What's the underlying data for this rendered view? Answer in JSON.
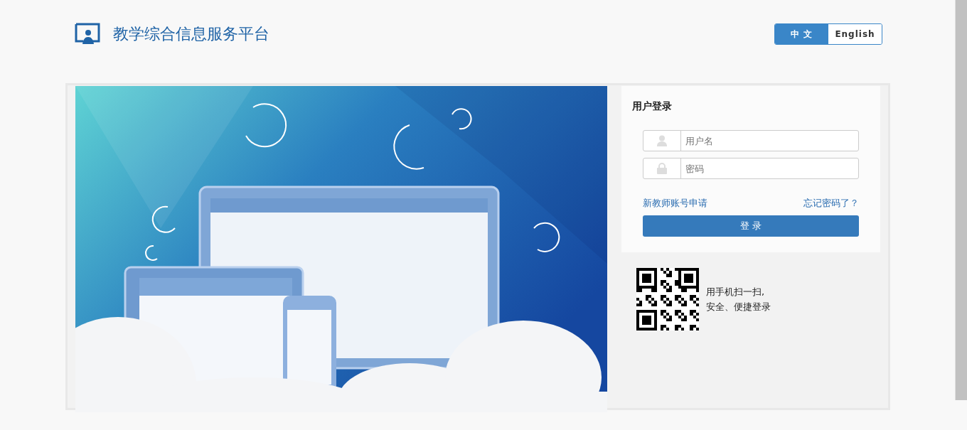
{
  "header": {
    "title": "教学综合信息服务平台"
  },
  "languages": [
    {
      "label": "中 文",
      "selected": true
    },
    {
      "label": "English",
      "selected": false
    }
  ],
  "login": {
    "title": "用户登录",
    "fields": [
      {
        "kind": "user",
        "placeholder": "用户名"
      },
      {
        "kind": "lock",
        "placeholder": "密码"
      }
    ],
    "register_link": "新教师账号申请",
    "forgot_link": "忘记密码了？",
    "submit": "登 录"
  },
  "qr": {
    "lines": [
      "用手机扫一扫,",
      "安全、便捷登录"
    ]
  }
}
